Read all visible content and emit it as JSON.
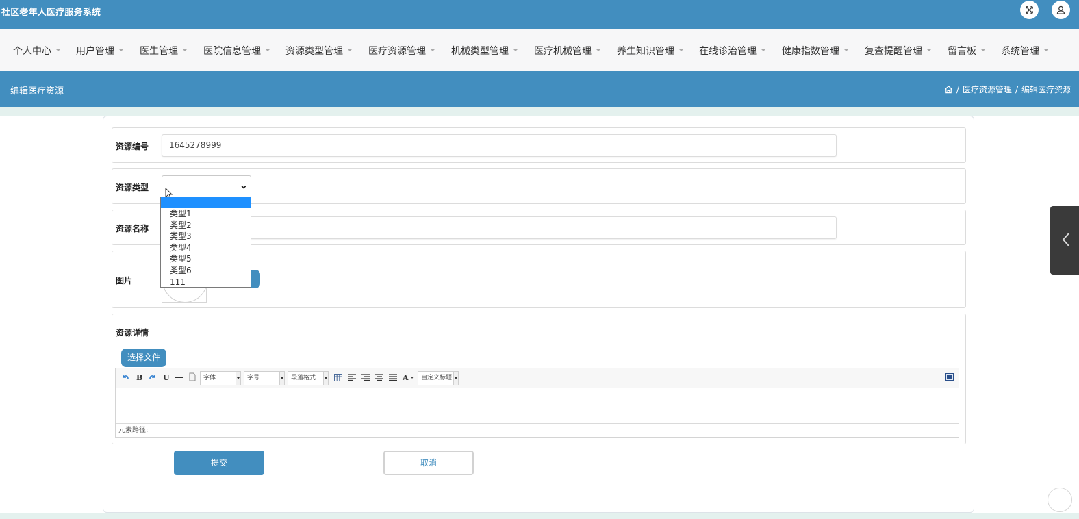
{
  "app": {
    "title": "社区老年人医疗服务系统"
  },
  "icons": {
    "fullscreen": "fullscreen-icon",
    "user": "user-icon",
    "home": "home-icon"
  },
  "nav": {
    "items": [
      {
        "label": "个人中心"
      },
      {
        "label": "用户管理"
      },
      {
        "label": "医生管理"
      },
      {
        "label": "医院信息管理"
      },
      {
        "label": "资源类型管理"
      },
      {
        "label": "医疗资源管理"
      },
      {
        "label": "机械类型管理"
      },
      {
        "label": "医疗机械管理"
      },
      {
        "label": "养生知识管理"
      },
      {
        "label": "在线诊治管理"
      },
      {
        "label": "健康指数管理"
      },
      {
        "label": "复查提醒管理"
      },
      {
        "label": "留言板"
      },
      {
        "label": "系统管理"
      }
    ]
  },
  "header": {
    "title": "编辑医疗资源",
    "breadcrumb": [
      "医疗资源管理",
      "编辑医疗资源"
    ],
    "separator": "/"
  },
  "form": {
    "resource_no": {
      "label": "资源编号",
      "value": "1645278999"
    },
    "resource_type": {
      "label": "资源类型",
      "value": "",
      "options": [
        "",
        "类型1",
        "类型2",
        "类型3",
        "类型4",
        "类型5",
        "类型6",
        "111"
      ]
    },
    "resource_name": {
      "label": "资源名称",
      "value": ""
    },
    "image": {
      "label": "图片",
      "upload_label": ""
    },
    "detail": {
      "label": "资源详情",
      "upload_label": "选择文件"
    },
    "submit_label": "提交",
    "cancel_label": "取消"
  },
  "editor": {
    "font_family": "字体",
    "font_size": "字号",
    "paragraph": "段落格式",
    "custom_title": "自定义标题",
    "bold": "B",
    "underline": "U",
    "font_color": "A",
    "path_label": "元素路径:"
  },
  "colors": {
    "primary": "#428ebf",
    "nav_bg": "#f7f7f8",
    "selected_option": "#1e90ff"
  }
}
